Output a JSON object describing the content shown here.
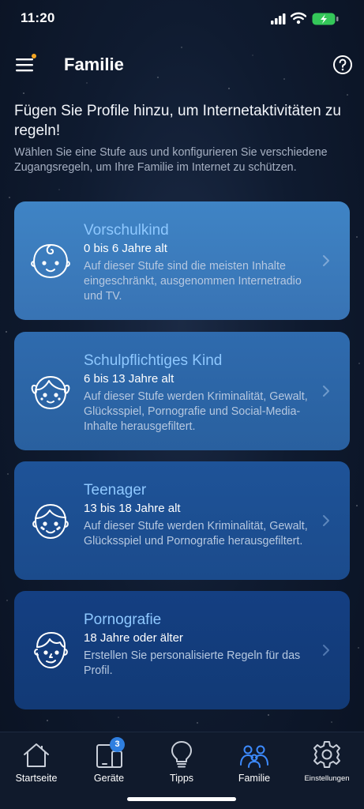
{
  "status_bar": {
    "time": "11:20"
  },
  "header": {
    "title": "Familie"
  },
  "intro": {
    "title": "Fügen Sie Profile hinzu, um Internetaktivitäten zu regeln!",
    "description": "Wählen Sie eine Stufe aus und konfigurieren Sie verschiedene Zugangsregeln, um Ihre Familie im Internet zu schützen."
  },
  "profiles": [
    {
      "icon": "baby-face-icon",
      "title": "Vorschulkind",
      "age": "0 bis 6 Jahre alt",
      "description": "Auf dieser Stufe sind die meisten Inhalte eingeschränkt, ausgenommen Internetradio und TV."
    },
    {
      "icon": "girl-face-icon",
      "title": "Schulpflichtiges Kind",
      "age": "6 bis 13 Jahre alt",
      "description": "Auf dieser Stufe werden Kriminalität, Gewalt, Glücksspiel, Pornografie und Social-Media-Inhalte herausgefiltert."
    },
    {
      "icon": "teen-face-icon",
      "title": "Teenager",
      "age": "13 bis 18 Jahre alt",
      "description": "Auf dieser Stufe werden Kriminalität, Gewalt, Glücksspiel und Pornografie herausgefiltert."
    },
    {
      "icon": "adult-face-icon",
      "title": "Pornografie",
      "age": "18 Jahre oder älter",
      "description": "Erstellen Sie personalisierte Regeln für das Profil."
    }
  ],
  "tab_bar": {
    "tabs": [
      {
        "label": "Startseite",
        "icon": "home-icon"
      },
      {
        "label": "Geräte",
        "icon": "devices-icon",
        "badge": "3"
      },
      {
        "label": "Tipps",
        "icon": "lightbulb-icon"
      },
      {
        "label": "Familie",
        "icon": "family-icon",
        "active": true
      },
      {
        "label": "Einstellungen",
        "icon": "gear-icon"
      }
    ]
  },
  "colors": {
    "accent": "#3d8bff",
    "card_title": "#8ec8ff",
    "badge": "#2f7fe0",
    "menu_notification": "#f5a623",
    "battery": "#34c759"
  }
}
